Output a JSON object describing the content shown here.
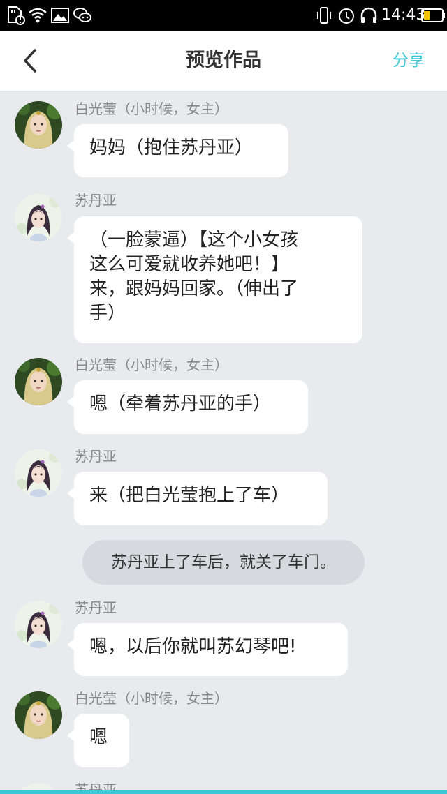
{
  "status_bar": {
    "time": "14:43",
    "icons": [
      "sim-card-alert-icon",
      "wifi-icon",
      "image-icon",
      "wechat-icon",
      "vibrate-icon",
      "alarm-icon",
      "headphones-icon",
      "battery-icon"
    ]
  },
  "nav": {
    "back_icon": "chevron-left-icon",
    "title": "预览作品",
    "share_label": "分享",
    "accent_color": "#3cc6d6"
  },
  "messages": [
    {
      "type": "bubble",
      "sender": "白光莹（小时候，女主）",
      "avatar": "blonde-girl-avatar",
      "lines": [
        "妈妈（抱住苏丹亚）"
      ]
    },
    {
      "type": "bubble",
      "sender": "苏丹亚",
      "avatar": "dark-hair-woman-avatar",
      "lines": [
        "（一脸蒙逼）【这个小女孩",
        "这么可爱就收养她吧！】",
        "来，跟妈妈回家。（伸出了",
        "手）"
      ]
    },
    {
      "type": "bubble",
      "sender": "白光莹（小时候，女主）",
      "avatar": "blonde-girl-avatar",
      "lines": [
        "嗯（牵着苏丹亚的手）"
      ]
    },
    {
      "type": "bubble",
      "sender": "苏丹亚",
      "avatar": "dark-hair-woman-avatar",
      "lines": [
        "来（把白光莹抱上了车）"
      ]
    },
    {
      "type": "narration",
      "text": "苏丹亚上了车后，就关了车门。"
    },
    {
      "type": "bubble",
      "sender": "苏丹亚",
      "avatar": "dark-hair-woman-avatar",
      "lines": [
        "嗯，以后你就叫苏幻琴吧!"
      ]
    },
    {
      "type": "bubble",
      "sender": "白光莹（小时候，女主）",
      "avatar": "blonde-girl-avatar",
      "lines": [
        "嗯"
      ]
    },
    {
      "type": "bubble",
      "sender": "苏丹亚",
      "avatar": "dark-hair-woman-avatar",
      "lines": []
    }
  ]
}
